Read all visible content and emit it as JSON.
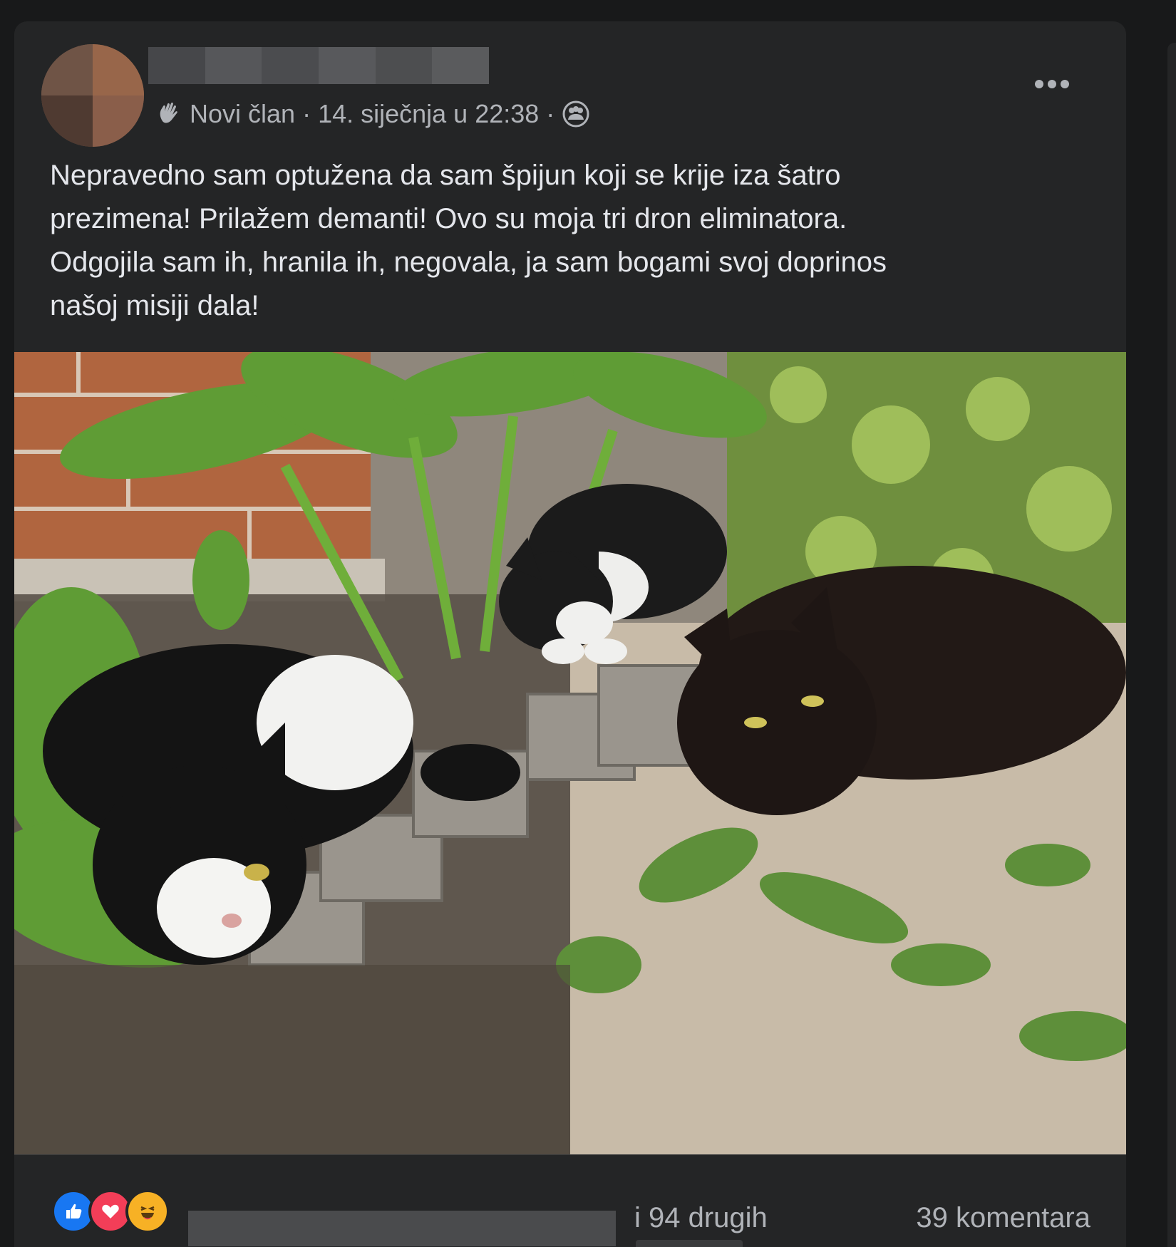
{
  "post": {
    "meta": {
      "badge": "Novi član",
      "separator": "·",
      "timestamp": "14. siječnja u 22:38",
      "audience_icon": "group-audience-icon"
    },
    "text": "Nepravedno sam optužena da sam špijun koji se krije iza šatro\nprezimena! Prilažem demanti! Ovo su moja tri dron eliminatora.\nOdgojila sam ih, hranila ih, negovala, ja sam bogami svoj doprinos\nnašoj misiji dala!",
    "more_icon": "more-options-icon",
    "photo_icon": "photo-three-cats-garden"
  },
  "footer": {
    "reactions": [
      "like-icon",
      "love-icon",
      "haha-icon"
    ],
    "others_text": "i 94 drugih",
    "comments_text": "39 komentara"
  },
  "colors": {
    "background": "#18191a",
    "card": "#242526",
    "text_primary": "#e4e6eb",
    "text_secondary": "#b0b3b8",
    "like": "#1877f2",
    "love": "#f33e58",
    "haha": "#f7b125"
  }
}
